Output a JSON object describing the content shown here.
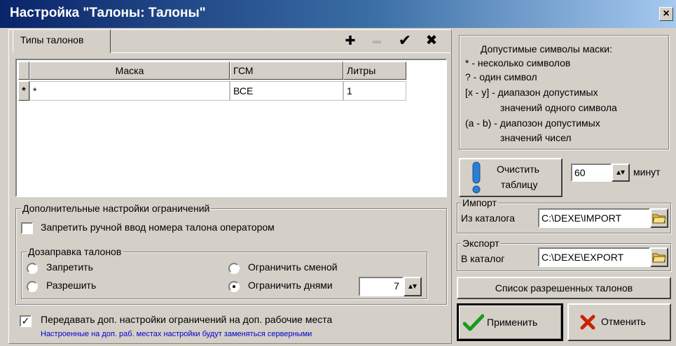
{
  "window": {
    "title": "Настройка \"Талоны: Талоны\"",
    "close": "×"
  },
  "tabs": [
    {
      "label": "Типы талонов"
    }
  ],
  "toolbar": {
    "add": "✚",
    "remove": "▬",
    "apply": "✔",
    "cancel": "✖"
  },
  "grid": {
    "columns": [
      "Маска",
      "ГСМ",
      "Литры"
    ],
    "rows": [
      {
        "indicator": "*",
        "mask": "*",
        "fuel": "ВСЕ",
        "liters": "1"
      }
    ]
  },
  "mask_help": {
    "title": "Допустимые символы маски:",
    "lines": [
      "* - несколько символов",
      "? - один символ",
      "[x - y] - диапазон допустимых",
      "значений одного символа",
      "(a - b) - диапозон допустимых",
      "значений чисел"
    ]
  },
  "clear": {
    "label1": "Очистить",
    "label2": "таблицу",
    "minutes": "60",
    "minutes_unit": "минут"
  },
  "import": {
    "legend": "Импорт",
    "label": "Из каталога",
    "path": "C:\\DEXE\\IMPORT"
  },
  "export": {
    "legend": "Экспорт",
    "label": "В каталог",
    "path": "C:\\DEXE\\EXPORT"
  },
  "allowed_list_button": "Список разрешенных талонов",
  "restrictions": {
    "legend": "Дополнительные настройки ограничений",
    "forbid_manual": {
      "label": "Запретить ручной ввод номера талона оператором",
      "checked": false
    },
    "refuel": {
      "legend": "Дозаправка талонов",
      "options": [
        {
          "label": "Запретить",
          "checked": false
        },
        {
          "label": "Разрешить",
          "checked": false
        },
        {
          "label": "Ограничить сменой",
          "checked": false
        },
        {
          "label": "Ограничить днями",
          "checked": true
        }
      ],
      "days": "7"
    }
  },
  "pass_settings": {
    "label": "Передавать доп. настройки ограничений на доп. рабочие места",
    "checked": true,
    "note": "Настроенные на доп. раб. местах настройки будут заменяться серверными",
    "note_color": "#0000cc"
  },
  "buttons": {
    "apply": "Применить",
    "cancel": "Отменить"
  },
  "colors": {
    "apply_icon": "#1a9a1a",
    "cancel_icon": "#cc2200",
    "hint_icon": "#2a7fd4"
  }
}
